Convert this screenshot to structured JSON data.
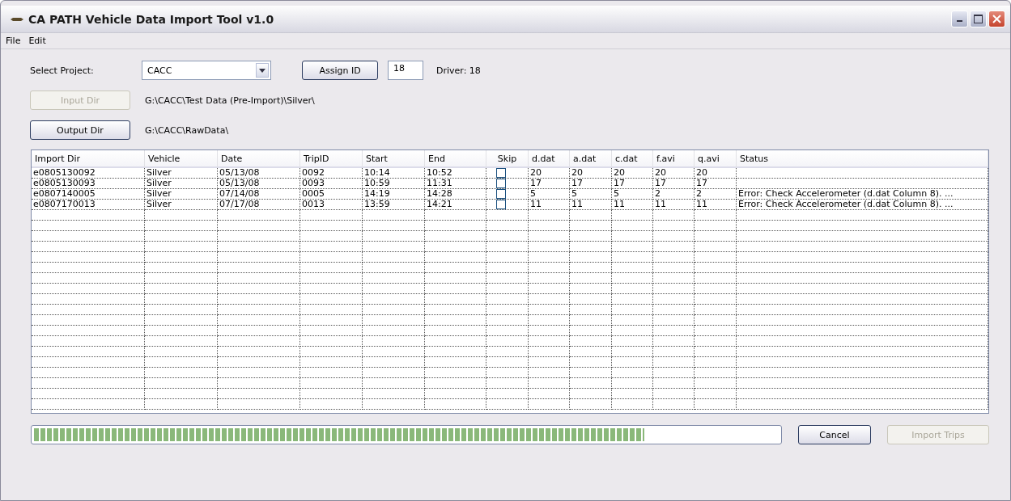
{
  "window": {
    "title": "CA PATH Vehicle Data Import Tool v1.0"
  },
  "menu": [
    "File",
    "Edit"
  ],
  "project": {
    "label": "Select Project:",
    "value": "CACC"
  },
  "assign_button": {
    "label": "Assign ID",
    "disabled": false
  },
  "id_field": {
    "value": "18"
  },
  "driver": "Driver: 18",
  "input_dir": {
    "button": "Input Dir",
    "disabled": true,
    "path": "G:\\CACC\\Test Data (Pre-Import)\\Silver\\"
  },
  "output_dir": {
    "button": "Output Dir",
    "disabled": false,
    "path": "G:\\CACC\\RawData\\"
  },
  "table": {
    "columns": [
      "Import Dir",
      "Vehicle",
      "Date",
      "TripID",
      "Start",
      "End",
      "Skip",
      "d.dat",
      "a.dat",
      "c.dat",
      "f.avi",
      "q.avi",
      "Status"
    ],
    "rows": [
      {
        "cells": [
          "e0805130092",
          "Silver",
          "05/13/08",
          "0092",
          "10:14",
          "10:52",
          "",
          "20",
          "20",
          "20",
          "20",
          "20",
          ""
        ],
        "skip": false
      },
      {
        "cells": [
          "e0805130093",
          "Silver",
          "05/13/08",
          "0093",
          "10:59",
          "11:31",
          "",
          "17",
          "17",
          "17",
          "17",
          "17",
          ""
        ],
        "skip": false
      },
      {
        "cells": [
          "e0807140005",
          "Silver",
          "07/14/08",
          "0005",
          "14:19",
          "14:28",
          "",
          "5",
          "5",
          "5",
          "2",
          "2",
          "Error: Check Accelerometer (d.dat Column 8). ..."
        ],
        "skip": false
      },
      {
        "cells": [
          "e0807170013",
          "Silver",
          "07/17/08",
          "0013",
          "13:59",
          "14:21",
          "",
          "11",
          "11",
          "11",
          "11",
          "11",
          "Error: Check Accelerometer (d.dat Column 8). ..."
        ],
        "skip": false
      }
    ]
  },
  "progress": {
    "level": 0.82
  },
  "cancel_button": {
    "label": "Cancel",
    "disabled": false
  },
  "import_button": {
    "label": "Import Trips",
    "disabled": true
  }
}
